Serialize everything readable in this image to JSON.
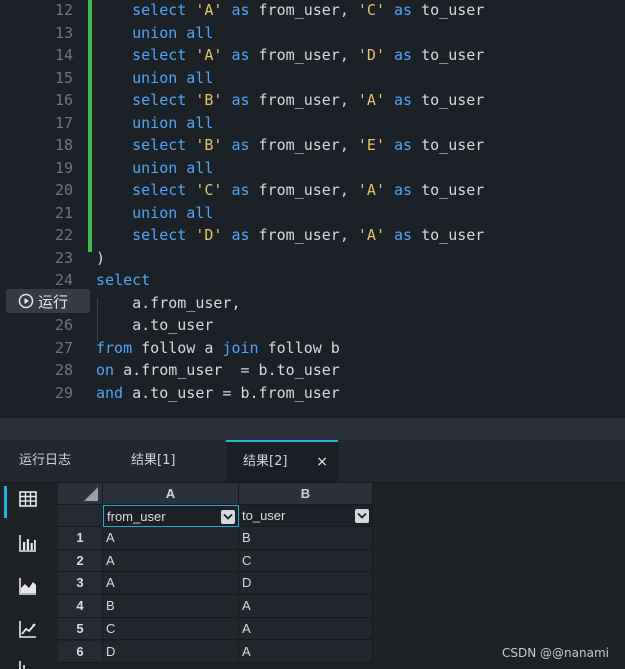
{
  "editor": {
    "lines": [
      {
        "num": "12",
        "tokens": [
          {
            "t": "    "
          },
          {
            "t": "select",
            "k": "kw"
          },
          {
            "t": " "
          },
          {
            "t": "'A'",
            "k": "str"
          },
          {
            "t": " "
          },
          {
            "t": "as",
            "k": "kw"
          },
          {
            "t": " from_user, "
          },
          {
            "t": "'C'",
            "k": "str"
          },
          {
            "t": " "
          },
          {
            "t": "as",
            "k": "kw"
          },
          {
            "t": " to_user"
          }
        ]
      },
      {
        "num": "13",
        "tokens": [
          {
            "t": "    "
          },
          {
            "t": "union all",
            "k": "kw"
          }
        ]
      },
      {
        "num": "14",
        "tokens": [
          {
            "t": "    "
          },
          {
            "t": "select",
            "k": "kw"
          },
          {
            "t": " "
          },
          {
            "t": "'A'",
            "k": "str"
          },
          {
            "t": " "
          },
          {
            "t": "as",
            "k": "kw"
          },
          {
            "t": " from_user, "
          },
          {
            "t": "'D'",
            "k": "str"
          },
          {
            "t": " "
          },
          {
            "t": "as",
            "k": "kw"
          },
          {
            "t": " to_user"
          }
        ]
      },
      {
        "num": "15",
        "tokens": [
          {
            "t": "    "
          },
          {
            "t": "union all",
            "k": "kw"
          }
        ]
      },
      {
        "num": "16",
        "tokens": [
          {
            "t": "    "
          },
          {
            "t": "select",
            "k": "kw"
          },
          {
            "t": " "
          },
          {
            "t": "'B'",
            "k": "str"
          },
          {
            "t": " "
          },
          {
            "t": "as",
            "k": "kw"
          },
          {
            "t": " from_user, "
          },
          {
            "t": "'A'",
            "k": "str"
          },
          {
            "t": " "
          },
          {
            "t": "as",
            "k": "kw"
          },
          {
            "t": " to_user"
          }
        ]
      },
      {
        "num": "17",
        "tokens": [
          {
            "t": "    "
          },
          {
            "t": "union all",
            "k": "kw"
          }
        ]
      },
      {
        "num": "18",
        "tokens": [
          {
            "t": "    "
          },
          {
            "t": "select",
            "k": "kw"
          },
          {
            "t": " "
          },
          {
            "t": "'B'",
            "k": "str"
          },
          {
            "t": " "
          },
          {
            "t": "as",
            "k": "kw"
          },
          {
            "t": " from_user, "
          },
          {
            "t": "'E'",
            "k": "str"
          },
          {
            "t": " "
          },
          {
            "t": "as",
            "k": "kw"
          },
          {
            "t": " to_user"
          }
        ]
      },
      {
        "num": "19",
        "tokens": [
          {
            "t": "    "
          },
          {
            "t": "union all",
            "k": "kw"
          }
        ]
      },
      {
        "num": "20",
        "tokens": [
          {
            "t": "    "
          },
          {
            "t": "select",
            "k": "kw"
          },
          {
            "t": " "
          },
          {
            "t": "'C'",
            "k": "str"
          },
          {
            "t": " "
          },
          {
            "t": "as",
            "k": "kw"
          },
          {
            "t": " from_user, "
          },
          {
            "t": "'A'",
            "k": "str"
          },
          {
            "t": " "
          },
          {
            "t": "as",
            "k": "kw"
          },
          {
            "t": " to_user"
          }
        ]
      },
      {
        "num": "21",
        "tokens": [
          {
            "t": "    "
          },
          {
            "t": "union all",
            "k": "kw"
          }
        ]
      },
      {
        "num": "22",
        "tokens": [
          {
            "t": "    "
          },
          {
            "t": "select",
            "k": "kw"
          },
          {
            "t": " "
          },
          {
            "t": "'D'",
            "k": "str"
          },
          {
            "t": " "
          },
          {
            "t": "as",
            "k": "kw"
          },
          {
            "t": " from_user, "
          },
          {
            "t": "'A'",
            "k": "str"
          },
          {
            "t": " "
          },
          {
            "t": "as",
            "k": "kw"
          },
          {
            "t": " to_user"
          }
        ]
      },
      {
        "num": "23",
        "tokens": [
          {
            "t": ")"
          }
        ]
      },
      {
        "num": "24",
        "tokens": [
          {
            "t": "select",
            "k": "kw"
          }
        ]
      },
      {
        "num": "25",
        "tokens": [
          {
            "t": "    a.from_user,"
          }
        ]
      },
      {
        "num": "26",
        "tokens": [
          {
            "t": "    a.to_user"
          }
        ]
      },
      {
        "num": "27",
        "tokens": [
          {
            "t": "from",
            "k": "kw"
          },
          {
            "t": " follow a "
          },
          {
            "t": "join",
            "k": "kw"
          },
          {
            "t": " follow b"
          }
        ]
      },
      {
        "num": "28",
        "tokens": [
          {
            "t": "on",
            "k": "kw"
          },
          {
            "t": " a.from_user  = b.to_user"
          }
        ]
      },
      {
        "num": "29",
        "tokens": [
          {
            "t": "and",
            "k": "kw"
          },
          {
            "t": " a.to_user = b.from_user"
          }
        ]
      }
    ],
    "run_button_label": "运行",
    "run_line_num": "25"
  },
  "tabs": [
    {
      "label": "运行日志",
      "active": false
    },
    {
      "label": "结果[1]",
      "active": false
    },
    {
      "label": "结果[2]",
      "active": true,
      "close": "×"
    }
  ],
  "sidebar": {
    "icons": [
      {
        "name": "table-icon",
        "active": true
      },
      {
        "name": "bar-chart-icon",
        "active": false
      },
      {
        "name": "area-chart-icon",
        "active": false
      },
      {
        "name": "line-chart-icon",
        "active": false
      }
    ]
  },
  "grid": {
    "columns": [
      {
        "letter": "A",
        "field": "from_user"
      },
      {
        "letter": "B",
        "field": "to_user"
      }
    ],
    "rows": [
      {
        "num": "1",
        "cells": [
          "A",
          "B"
        ]
      },
      {
        "num": "2",
        "cells": [
          "A",
          "C"
        ]
      },
      {
        "num": "3",
        "cells": [
          "A",
          "D"
        ]
      },
      {
        "num": "4",
        "cells": [
          "B",
          "A"
        ]
      },
      {
        "num": "5",
        "cells": [
          "C",
          "A"
        ]
      },
      {
        "num": "6",
        "cells": [
          "D",
          "A"
        ]
      }
    ]
  },
  "watermark": "CSDN @@nanami",
  "colors": {
    "keyword": "#4ea6f5",
    "string": "#e3c46a",
    "accent": "#26b3d8",
    "gutter_marker": "#3fba52"
  }
}
